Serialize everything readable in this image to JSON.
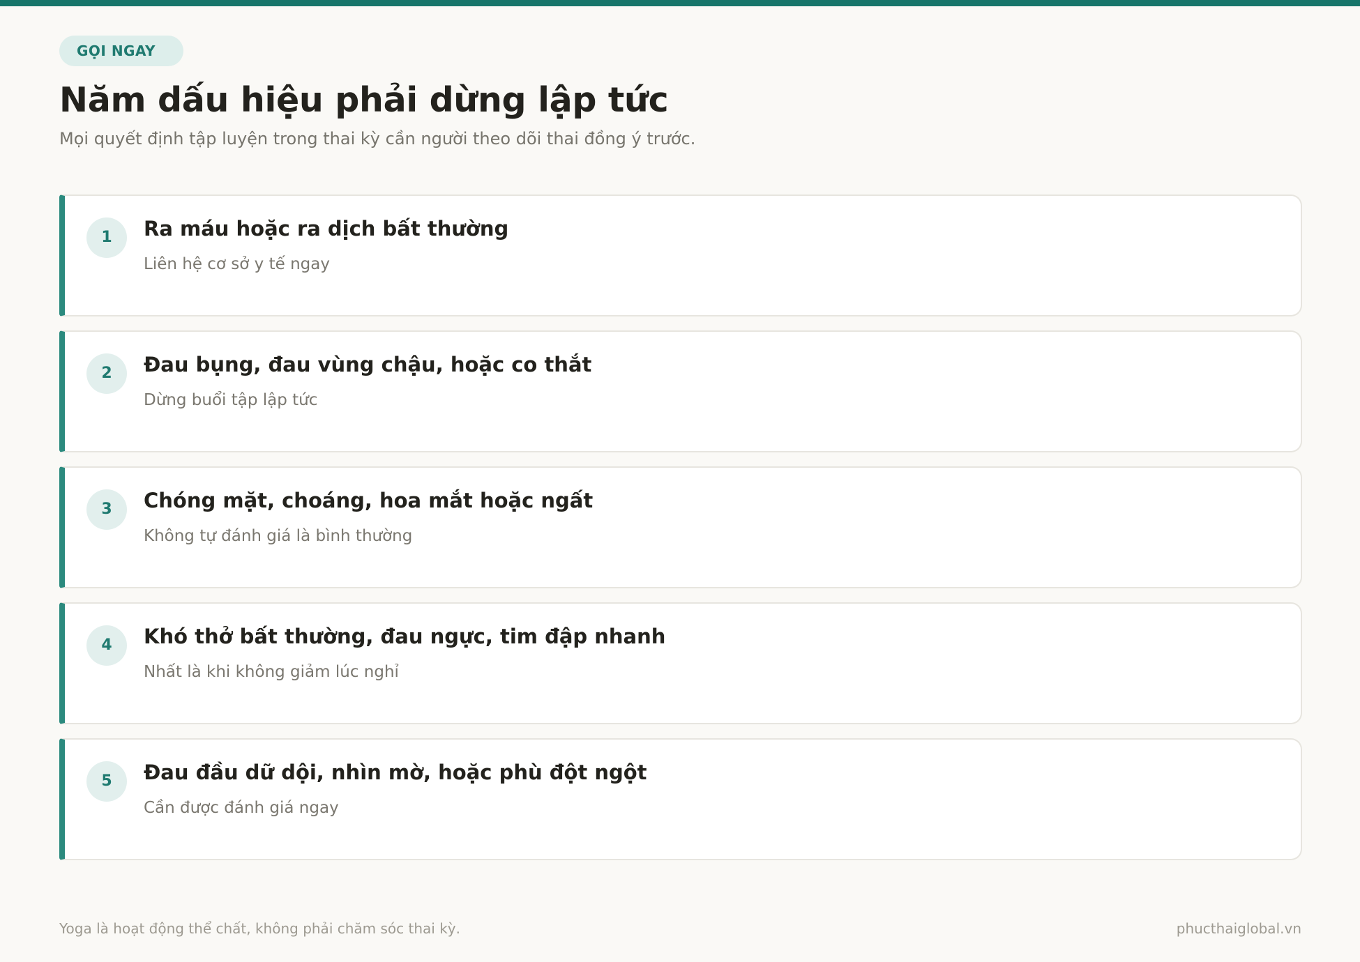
{
  "colors": {
    "accent": "#17756a",
    "badge_bg": "#ddeeeb",
    "card_border_accent": "#2b8a7e",
    "background": "#faf9f6"
  },
  "header": {
    "badge": "GỌI NGAY",
    "title": "Năm dấu hiệu phải dừng lập tức",
    "subtitle": "Mọi quyết định tập luyện trong thai kỳ cần người theo dõi thai đồng ý trước."
  },
  "signs": [
    {
      "number": "1",
      "title": "Ra máu hoặc ra dịch bất thường",
      "detail": "Liên hệ cơ sở y tế ngay"
    },
    {
      "number": "2",
      "title": "Đau bụng, đau vùng chậu, hoặc co thắt",
      "detail": "Dừng buổi tập lập tức"
    },
    {
      "number": "3",
      "title": "Chóng mặt, choáng, hoa mắt hoặc ngất",
      "detail": "Không tự đánh giá là bình thường"
    },
    {
      "number": "4",
      "title": "Khó thở bất thường, đau ngực, tim đập nhanh",
      "detail": "Nhất là khi không giảm lúc nghỉ"
    },
    {
      "number": "5",
      "title": "Đau đầu dữ dội, nhìn mờ, hoặc phù đột ngột",
      "detail": "Cần được đánh giá ngay"
    }
  ],
  "footer": {
    "disclaimer": "Yoga là hoạt động thể chất, không phải chăm sóc thai kỳ.",
    "site": "phucthaiglobal.vn"
  }
}
